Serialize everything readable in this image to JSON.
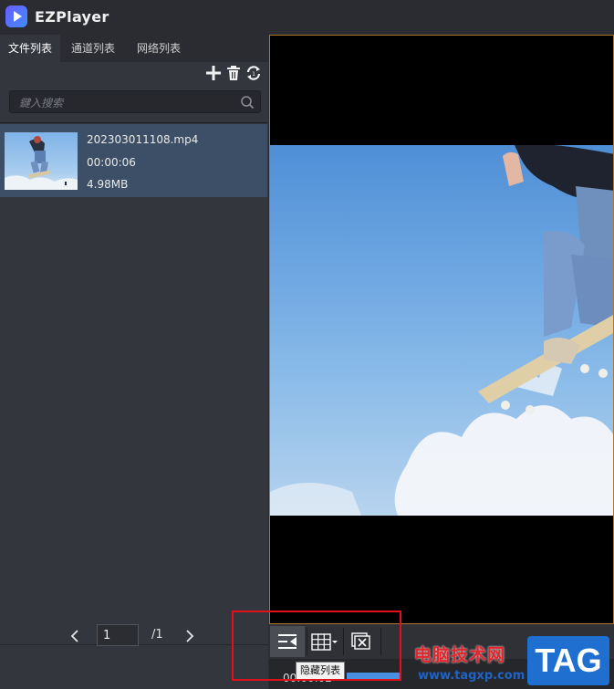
{
  "app": {
    "title": "EZPlayer"
  },
  "tabs": [
    {
      "label": "文件列表",
      "active": true
    },
    {
      "label": "通道列表",
      "active": false
    },
    {
      "label": "网络列表",
      "active": false
    }
  ],
  "toolbar": {
    "icons": [
      "add-icon",
      "trash-icon",
      "loop-icon"
    ]
  },
  "search": {
    "placeholder": "鍵入搜索"
  },
  "files": [
    {
      "name": "202303011108.mp4",
      "duration": "00:00:06",
      "size": "4.98MB"
    }
  ],
  "pager": {
    "current": "1",
    "total": "/1"
  },
  "controls": {
    "icons": [
      "hide-list-icon",
      "grid-layout-icon",
      "close-all-icon"
    ],
    "tooltip": "隐藏列表",
    "time": "00:00:02",
    "progress_percent": 30
  },
  "watermark": {
    "text": "电脑技术网",
    "url": "www.tagxp.com",
    "badge": "TAG"
  },
  "colors": {
    "accent_border": "#b3742e",
    "selected_row": "#3c4f66",
    "highlight_box": "#e3101a",
    "progress": "#4a90e2"
  }
}
